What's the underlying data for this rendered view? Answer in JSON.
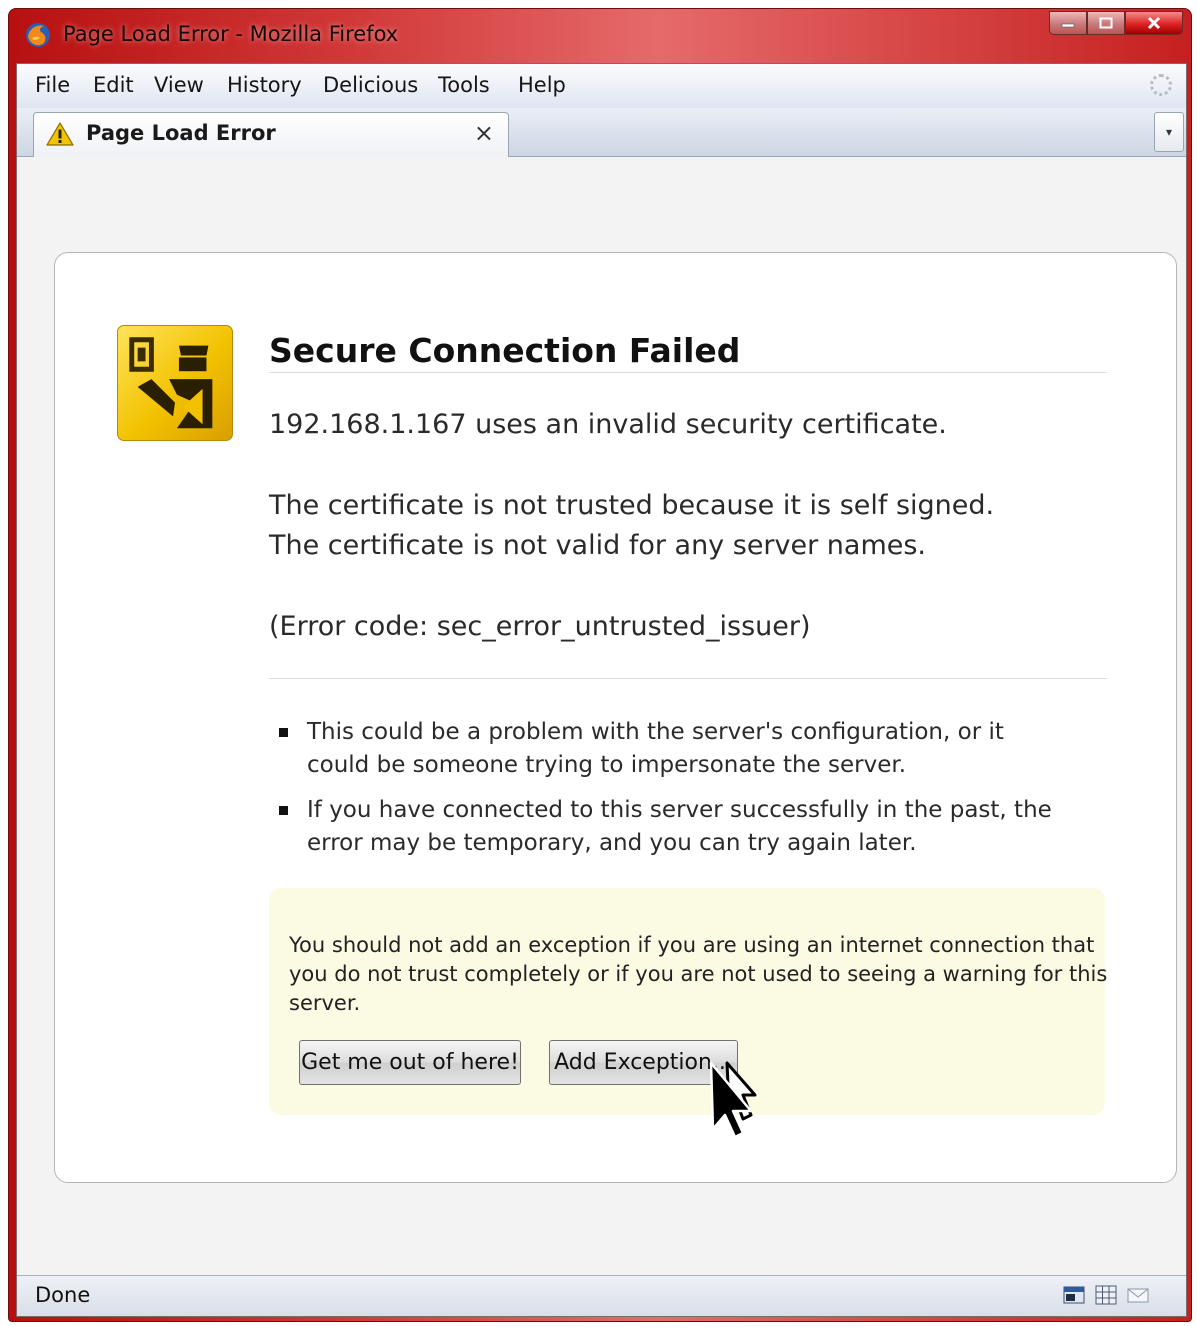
{
  "window": {
    "title": "Page Load Error - Mozilla Firefox"
  },
  "menu": {
    "items": [
      {
        "id": "file",
        "label": "File"
      },
      {
        "id": "edit",
        "label": "Edit"
      },
      {
        "id": "view",
        "label": "View"
      },
      {
        "id": "history",
        "label": "History"
      },
      {
        "id": "delicious",
        "label": "Delicious"
      },
      {
        "id": "tools",
        "label": "Tools"
      },
      {
        "id": "help",
        "label": "Help"
      }
    ]
  },
  "tab": {
    "label": "Page Load Error",
    "close_glyph": "×",
    "icon": "warning-icon"
  },
  "error": {
    "icon": "certificate-officer-icon",
    "heading": "Secure Connection Failed",
    "line_invalid": "192.168.1.167 uses an invalid security certificate.",
    "line_self_signed": "The certificate is not trusted because it is self signed.",
    "line_server_names": "The certificate is not valid for any server names.",
    "error_code": "(Error code: sec_error_untrusted_issuer)",
    "bullets": [
      {
        "lines": [
          "This could be a problem with the server's configuration, or it",
          "could be someone trying to impersonate the server."
        ]
      },
      {
        "lines": [
          "If you have connected to this server successfully in the past, the",
          "error may be temporary, and you can try again later."
        ]
      }
    ],
    "warning": {
      "lines": [
        "You should not add an exception if you are using an internet connection that",
        "you do not trust completely or if you are not used to seeing a warning for this",
        "server."
      ],
      "escape_button": "Get me out of here!",
      "exception_button": "Add Exception..."
    }
  },
  "status": {
    "text": "Done",
    "icons": [
      "page-icon",
      "grid-icon",
      "mail-icon"
    ]
  },
  "colors": {
    "titlebar_red": "#c62020",
    "warning_panel": "#fbfbe3",
    "icon_yellow": "#f2c200"
  }
}
